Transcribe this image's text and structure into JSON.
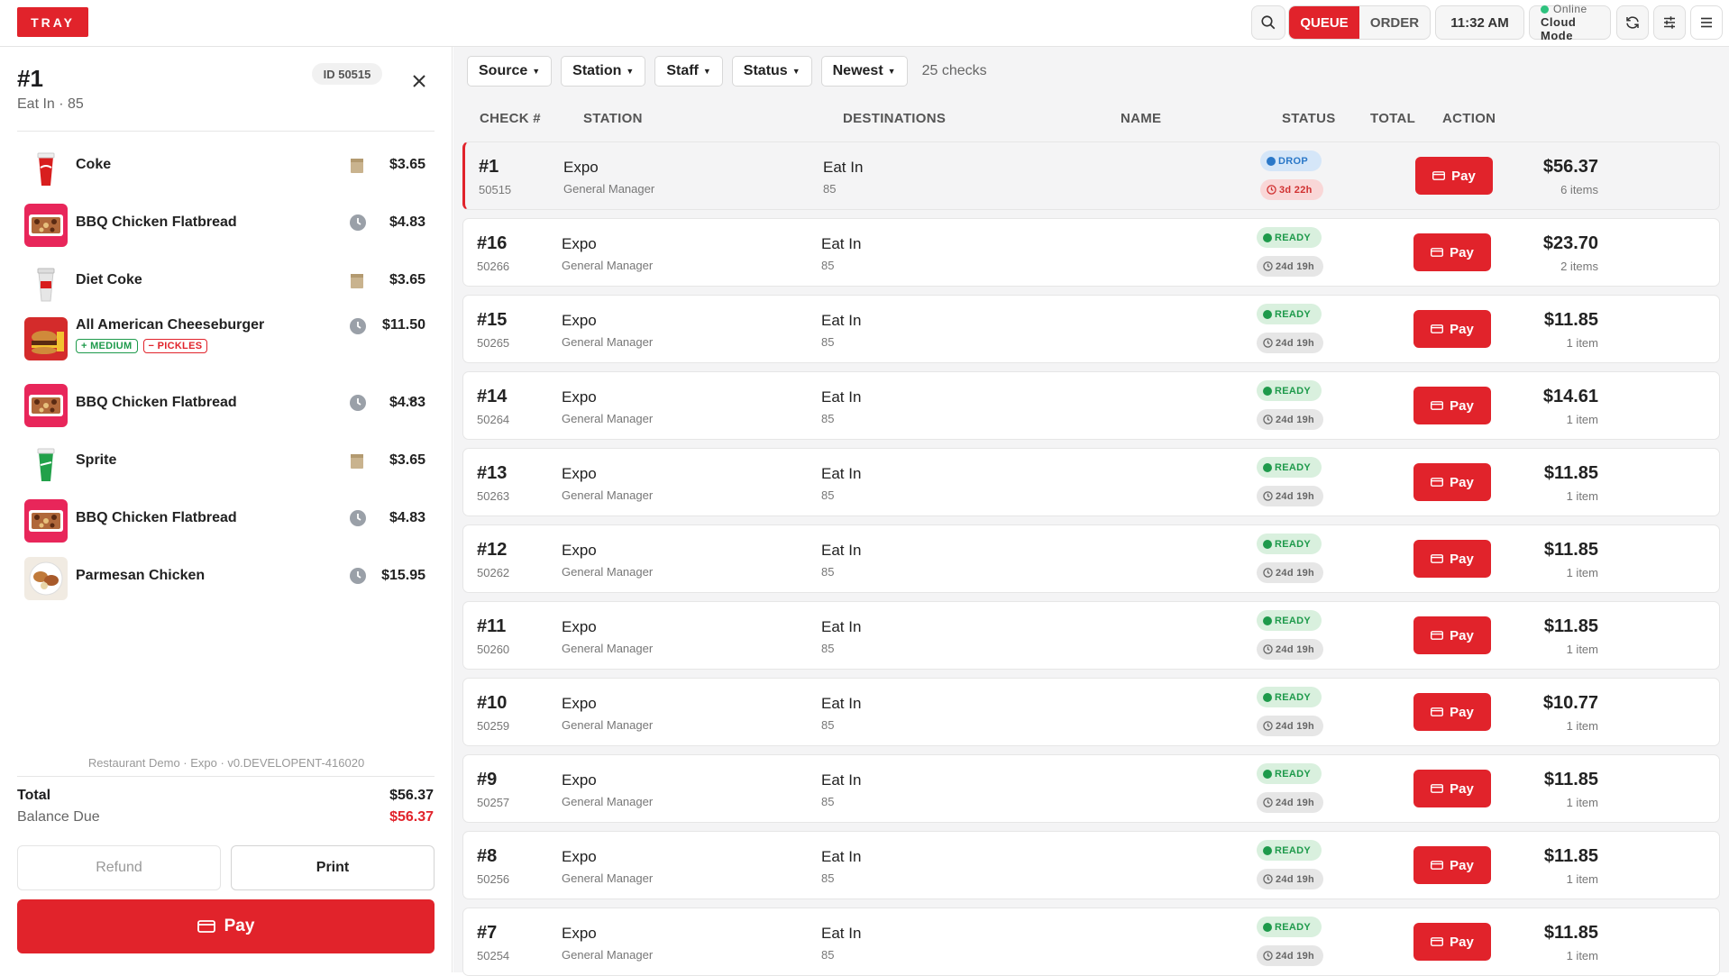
{
  "topbar": {
    "logo": "TRAY",
    "tabs": [
      "QUEUE",
      "ORDER"
    ],
    "time": "11:32 AM",
    "status_line1": "Online",
    "status_line2": "Cloud Mode"
  },
  "colors": {
    "accent": "#e1232b",
    "ready": "#1e9a4b",
    "drop": "#2b78c8",
    "online": "#2ec27e"
  },
  "detail": {
    "title": "#1",
    "subtitle": "Eat In · 85",
    "id_badge": "ID 50515",
    "items": [
      {
        "name": "Coke",
        "price": "$3.65",
        "status_icon": "bag-icon"
      },
      {
        "name": "BBQ Chicken Flatbread",
        "price": "$4.83",
        "status_icon": "clock-icon"
      },
      {
        "name": "Diet Coke",
        "price": "$3.65",
        "status_icon": "bag-icon"
      },
      {
        "name": "All American Cheeseburger",
        "price": "$11.50",
        "status_icon": "clock-icon",
        "mods": [
          "+ MEDIUM",
          "− PICKLES"
        ]
      },
      {
        "name": "BBQ Chicken Flatbread",
        "price": "$4.83",
        "status_icon": "clock-icon"
      },
      {
        "name": "Sprite",
        "price": "$3.65",
        "status_icon": "bag-icon"
      },
      {
        "name": "BBQ Chicken Flatbread",
        "price": "$4.83",
        "status_icon": "clock-icon"
      },
      {
        "name": "Parmesan Chicken",
        "price": "$15.95",
        "status_icon": "clock-icon"
      }
    ],
    "footer_note": "Restaurant Demo · Expo · v0.DEVELOPENT-416020",
    "total_label": "Total",
    "total_value": "$56.37",
    "balance_label": "Balance Due",
    "balance_value": "$56.37",
    "refund_label": "Refund",
    "print_label": "Print",
    "pay_label": "Pay"
  },
  "filters": {
    "buttons": [
      "Source",
      "Station",
      "Staff",
      "Status",
      "Newest"
    ],
    "count": "25 checks"
  },
  "table": {
    "headers": [
      "CHECK #",
      "STATION",
      "DESTINATIONS",
      "NAME",
      "STATUS",
      "TOTAL",
      "ACTION"
    ],
    "rows": [
      {
        "num": "#1",
        "id": "50515",
        "station": "Expo",
        "staff": "General Manager",
        "dest": "Eat In",
        "dest_sub": "85",
        "status": "DROP",
        "age": "3d 22h",
        "total": "$56.37",
        "items": "6 items",
        "action": "Pay"
      },
      {
        "num": "#16",
        "id": "50266",
        "station": "Expo",
        "staff": "General Manager",
        "dest": "Eat In",
        "dest_sub": "85",
        "status": "READY",
        "age": "24d 19h",
        "total": "$23.70",
        "items": "2 items",
        "action": "Pay"
      },
      {
        "num": "#15",
        "id": "50265",
        "station": "Expo",
        "staff": "General Manager",
        "dest": "Eat In",
        "dest_sub": "85",
        "status": "READY",
        "age": "24d 19h",
        "total": "$11.85",
        "items": "1 item",
        "action": "Pay"
      },
      {
        "num": "#14",
        "id": "50264",
        "station": "Expo",
        "staff": "General Manager",
        "dest": "Eat In",
        "dest_sub": "85",
        "status": "READY",
        "age": "24d 19h",
        "total": "$14.61",
        "items": "1 item",
        "action": "Pay"
      },
      {
        "num": "#13",
        "id": "50263",
        "station": "Expo",
        "staff": "General Manager",
        "dest": "Eat In",
        "dest_sub": "85",
        "status": "READY",
        "age": "24d 19h",
        "total": "$11.85",
        "items": "1 item",
        "action": "Pay"
      },
      {
        "num": "#12",
        "id": "50262",
        "station": "Expo",
        "staff": "General Manager",
        "dest": "Eat In",
        "dest_sub": "85",
        "status": "READY",
        "age": "24d 19h",
        "total": "$11.85",
        "items": "1 item",
        "action": "Pay"
      },
      {
        "num": "#11",
        "id": "50260",
        "station": "Expo",
        "staff": "General Manager",
        "dest": "Eat In",
        "dest_sub": "85",
        "status": "READY",
        "age": "24d 19h",
        "total": "$11.85",
        "items": "1 item",
        "action": "Pay"
      },
      {
        "num": "#10",
        "id": "50259",
        "station": "Expo",
        "staff": "General Manager",
        "dest": "Eat In",
        "dest_sub": "85",
        "status": "READY",
        "age": "24d 19h",
        "total": "$10.77",
        "items": "1 item",
        "action": "Pay"
      },
      {
        "num": "#9",
        "id": "50257",
        "station": "Expo",
        "staff": "General Manager",
        "dest": "Eat In",
        "dest_sub": "85",
        "status": "READY",
        "age": "24d 19h",
        "total": "$11.85",
        "items": "1 item",
        "action": "Pay"
      },
      {
        "num": "#8",
        "id": "50256",
        "station": "Expo",
        "staff": "General Manager",
        "dest": "Eat In",
        "dest_sub": "85",
        "status": "READY",
        "age": "24d 19h",
        "total": "$11.85",
        "items": "1 item",
        "action": "Pay"
      },
      {
        "num": "#7",
        "id": "50254",
        "station": "Expo",
        "staff": "General Manager",
        "dest": "Eat In",
        "dest_sub": "85",
        "status": "READY",
        "age": "24d 19h",
        "total": "$11.85",
        "items": "1 item",
        "action": "Pay"
      }
    ]
  }
}
